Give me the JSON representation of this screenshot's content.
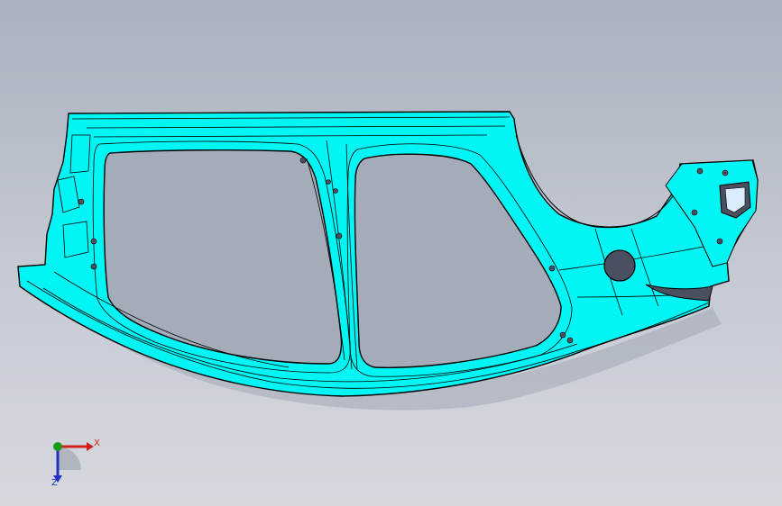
{
  "viewport": {
    "background_top": "#a9b1bf",
    "background_bottom": "#d6d8de"
  },
  "model": {
    "fill_color": "#00f5f5",
    "edge_color": "#000000",
    "shadow_color": "#7d8593"
  },
  "triad": {
    "x_label": "X",
    "z_label": "Z",
    "x_color": "#d32020",
    "y_color": "#1a9a1a",
    "z_color": "#2030c0"
  }
}
